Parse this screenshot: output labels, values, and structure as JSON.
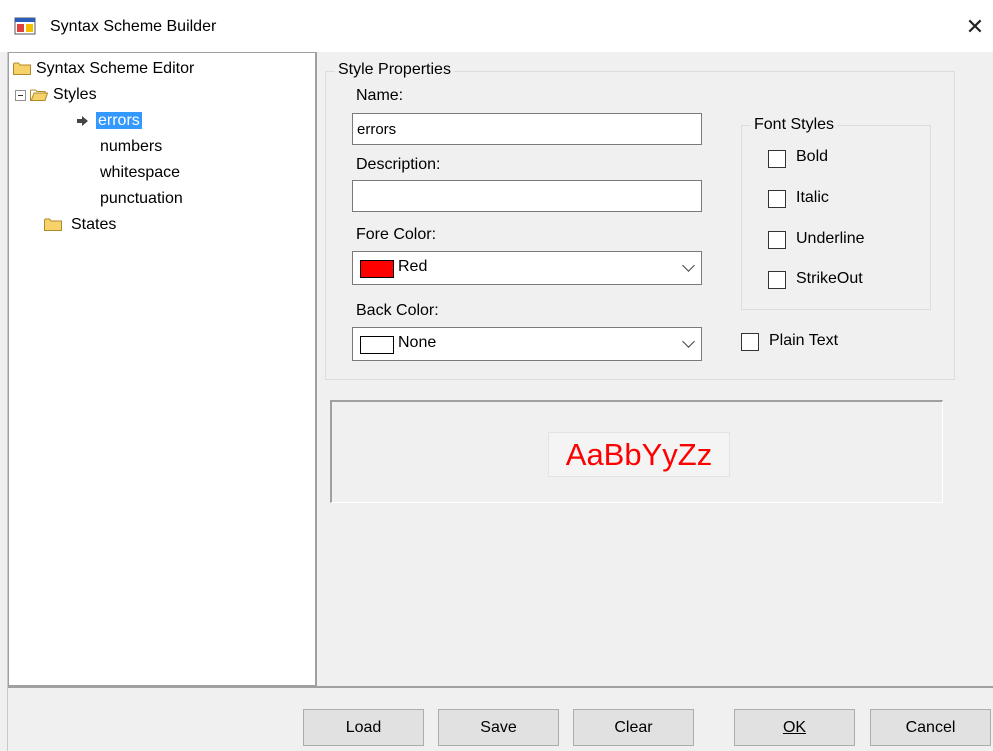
{
  "window": {
    "title": "Syntax Scheme Builder",
    "close_glyph": "✕"
  },
  "tree": {
    "root_label": "Syntax Scheme Editor",
    "styles_label": "Styles",
    "style_items": [
      "errors",
      "numbers",
      "whitespace",
      "punctuation"
    ],
    "selected_item": "errors",
    "states_label": "States"
  },
  "style_properties": {
    "group_label": "Style Properties",
    "name_label": "Name:",
    "name_value": "errors",
    "description_label": "Description:",
    "description_value": "",
    "fore_color_label": "Fore Color:",
    "fore_color_value": "Red",
    "fore_color_swatch": "#ff0000",
    "back_color_label": "Back Color:",
    "back_color_value": "None",
    "back_color_swatch": "#ffffff"
  },
  "font_styles": {
    "group_label": "Font Styles",
    "bold_label": "Bold",
    "italic_label": "Italic",
    "underline_label": "Underline",
    "strikeout_label": "StrikeOut",
    "bold_checked": false,
    "italic_checked": false,
    "underline_checked": false,
    "strikeout_checked": false
  },
  "plain_text": {
    "label": "Plain Text",
    "checked": false
  },
  "preview": {
    "sample_text": "AaBbYyZz",
    "color": "#ff0000"
  },
  "buttons": {
    "load": "Load",
    "save": "Save",
    "clear": "Clear",
    "ok": "OK",
    "cancel": "Cancel"
  },
  "icons": {
    "app": "app-window-icon",
    "folder": "folder-icon",
    "selected_arrow": "arrow-right-icon"
  }
}
